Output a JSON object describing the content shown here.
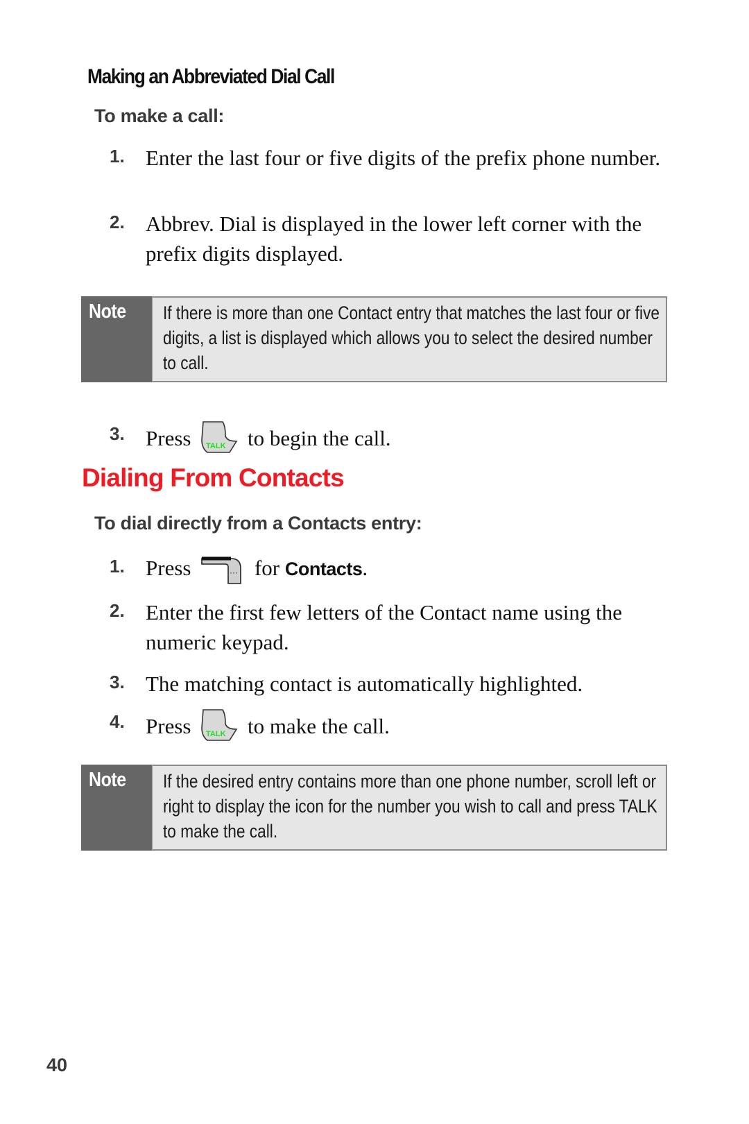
{
  "section1": {
    "heading": "Making an Abbreviated Dial Call",
    "procedure_title": "To make a call:",
    "steps": [
      {
        "num": "1.",
        "text": "Enter the last four or five digits of the prefix phone number."
      },
      {
        "num": "2.",
        "text": "Abbrev. Dial is displayed in the lower left corner with the prefix digits displayed."
      },
      {
        "num": "3.",
        "pre": "Press",
        "icon": "talk-key-icon",
        "post": "to begin the call."
      }
    ],
    "note": {
      "label": "Note",
      "text": "If there is more than one Contact entry that matches the last four or five digits, a list is displayed which allows you to select the desired number to call."
    }
  },
  "section2": {
    "heading": "Dialing From Contacts",
    "procedure_title": "To dial directly from a Contacts entry:",
    "steps": [
      {
        "num": "1.",
        "pre": "Press",
        "icon": "right-softkey-icon",
        "mid": "for",
        "bold": "Contacts",
        "post": "."
      },
      {
        "num": "2.",
        "text": "Enter the first few letters of the Contact name using the numeric keypad."
      },
      {
        "num": "3.",
        "text": "The matching contact is automatically highlighted."
      },
      {
        "num": "4.",
        "pre": "Press",
        "icon": "talk-key-icon",
        "post": "to make the call."
      }
    ],
    "note": {
      "label": "Note",
      "text": "If the desired entry contains more than one phone number, scroll left or right to display the icon for the number you wish to call and press TALK to make the call."
    }
  },
  "icons": {
    "talk_label": "TALK",
    "softkey_label": "···"
  },
  "colors": {
    "section_heading": "#ee1c25",
    "note_label_bg": "#666666",
    "note_bg": "#e6e6e6",
    "talk_text": "#22dd22"
  },
  "page_number": "40"
}
